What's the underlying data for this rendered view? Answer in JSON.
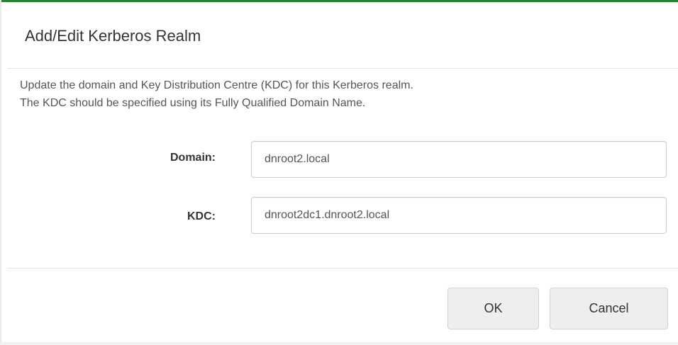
{
  "dialog": {
    "title": "Add/Edit Kerberos Realm",
    "description_line1": "Update the domain and Key Distribution Centre (KDC) for this Kerberos realm.",
    "description_line2": "The KDC should be specified using its Fully Qualified Domain Name."
  },
  "form": {
    "domain": {
      "label": "Domain:",
      "value": "dnroot2.local"
    },
    "kdc": {
      "label": "KDC:",
      "value": "dnroot2dc1.dnroot2.local"
    }
  },
  "footer": {
    "ok_label": "OK",
    "cancel_label": "Cancel"
  },
  "colors": {
    "accent_top_edge": "#2e7d32",
    "button_background": "#eeeeee",
    "divider": "#e5e5e5"
  }
}
